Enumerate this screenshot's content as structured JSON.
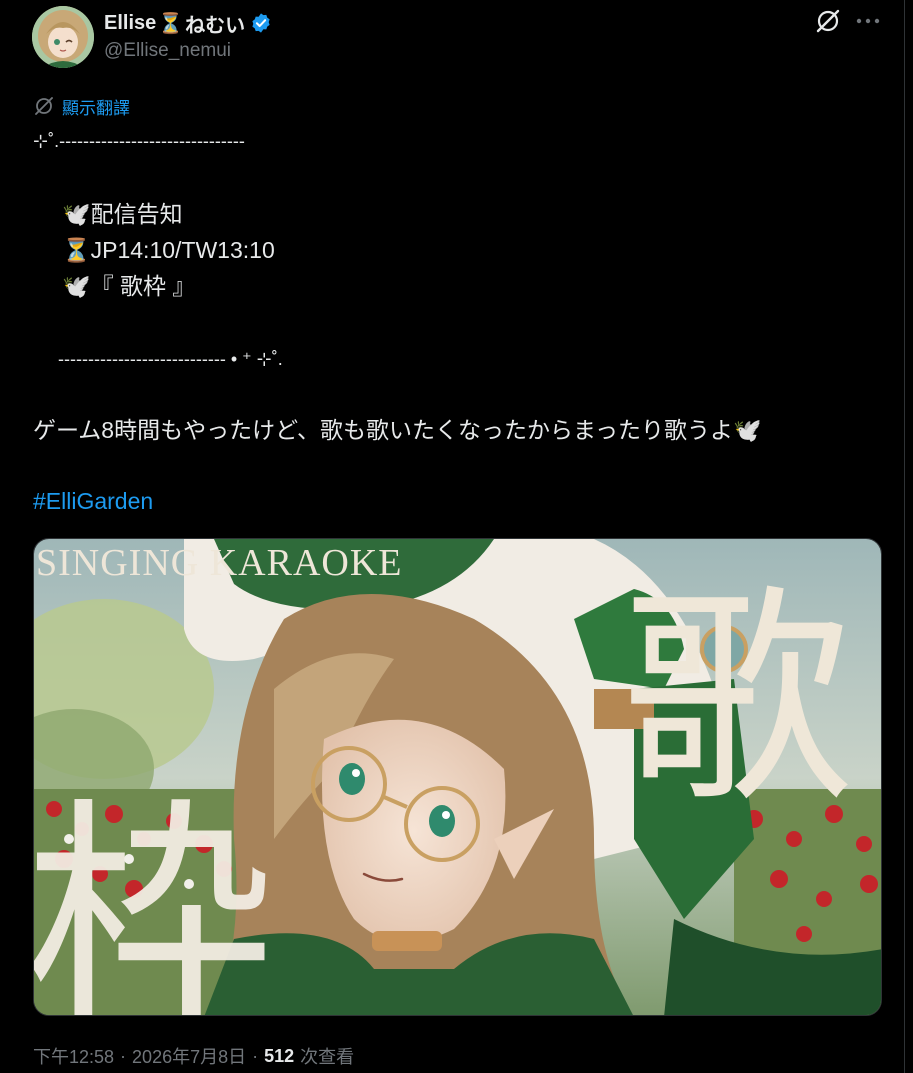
{
  "author": {
    "display_name": "Ellise",
    "display_name_suffix": "ねむい",
    "name_emoji": "⏳",
    "handle": "@Ellise_nemui",
    "verified": true,
    "avatar_icon": "avatar-icon"
  },
  "header_actions": {
    "grok_icon": "grok-icon",
    "more_icon": "more-icon"
  },
  "translate": {
    "label": "顯示翻譯",
    "icon": "translate-icon"
  },
  "tweet": {
    "lines": [
      "⊹˚.-------------------------------",
      "🕊️配信告知",
      "⏳JP14:10/TW13:10",
      "🕊️『 歌枠 』",
      "---------------------------- • ⁺ ⊹˚.",
      "ゲーム8時間もやったけど、歌も歌いたくなったからまったり歌うよ🕊️"
    ],
    "hashtag": "#ElliGarden"
  },
  "media": {
    "banner_text": "SINGING KARAOKE",
    "kanji_top": "歌",
    "kanji_bottom": "枠"
  },
  "meta": {
    "time": "下午12:58",
    "separator": "·",
    "date": "2026年7月8日",
    "views_count": "512",
    "views_label": "次查看"
  },
  "colors": {
    "background": "#000000",
    "text": "#e7e9ea",
    "secondary": "#71767b",
    "link": "#1d9bf0",
    "verified": "#1d9bf0",
    "border": "#2f3336"
  }
}
